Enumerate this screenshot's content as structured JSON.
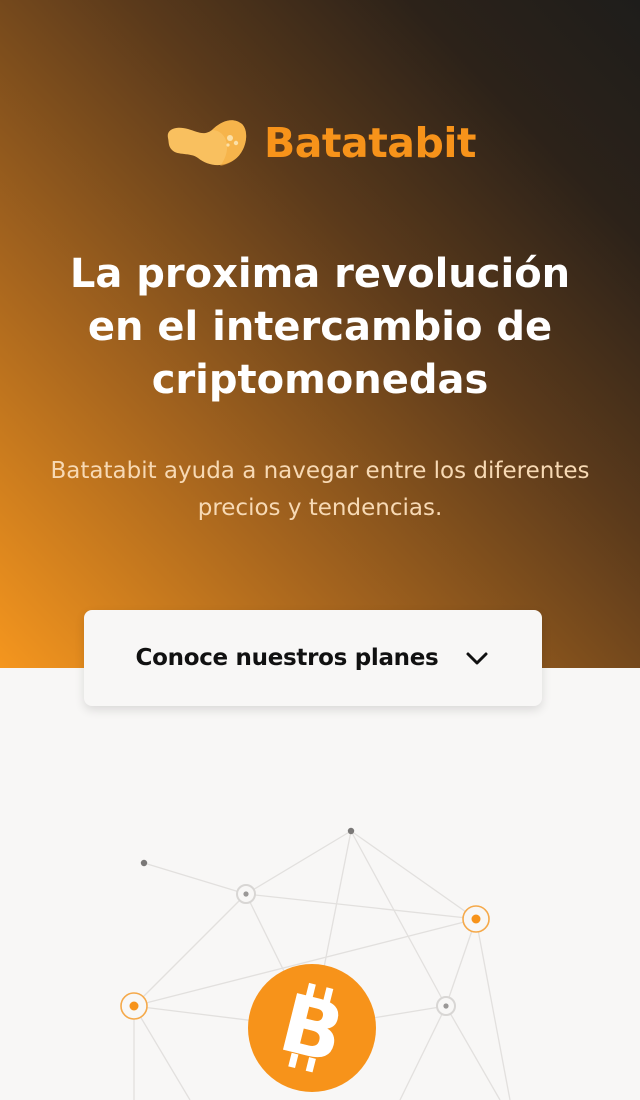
{
  "brand": {
    "name": "Batatabit",
    "logo_icon": "potato-logo-icon",
    "accent_color": "#f7931a"
  },
  "hero": {
    "title": "La proxima revolución en el intercambio de criptomonedas",
    "subtitle": "Batatabit ayuda a navegar entre los diferentes precios y tendencias."
  },
  "plans_button": {
    "label": "Conoce nuestros planes",
    "icon": "chevron-down-icon"
  },
  "illustration": {
    "icon": "bitcoin-icon",
    "coin_color": "#f7931a"
  }
}
